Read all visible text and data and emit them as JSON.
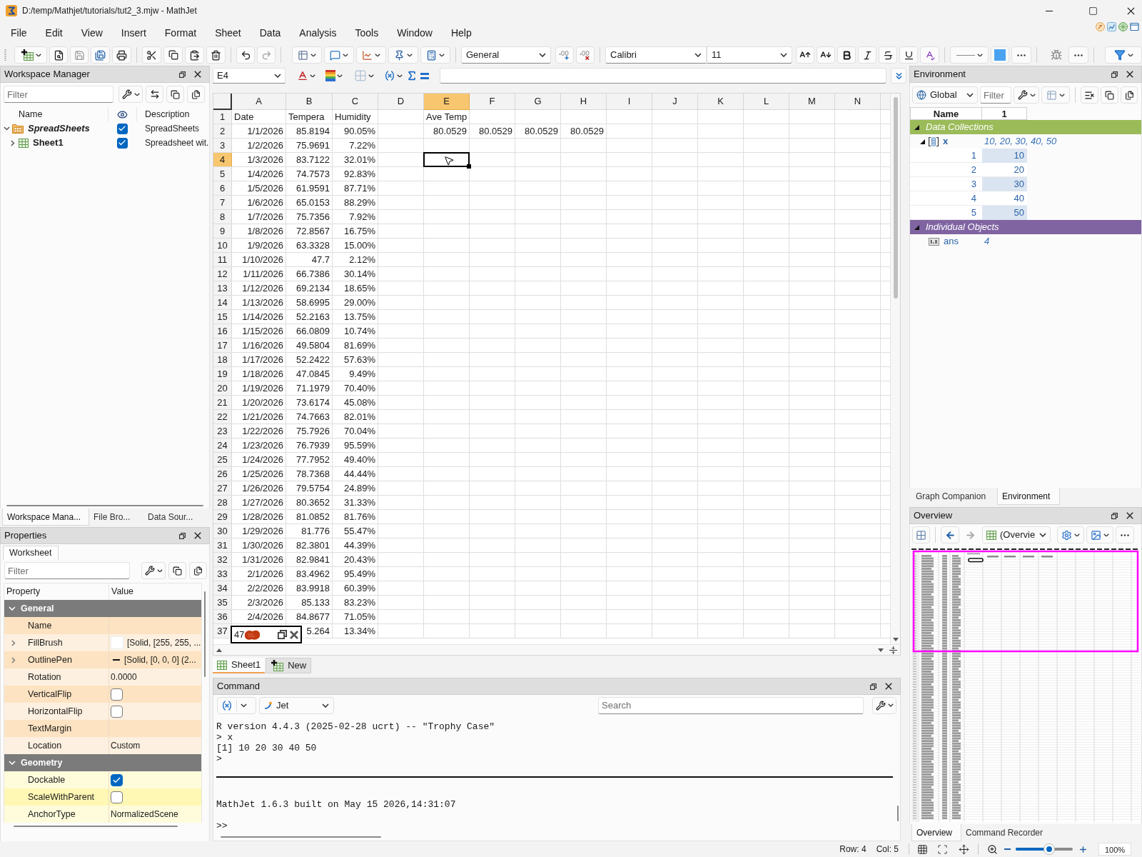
{
  "window": {
    "title": "D:/temp/Mathjet/tutorials/tut2_3.mjw - MathJet"
  },
  "menu": [
    "File",
    "Edit",
    "View",
    "Insert",
    "Format",
    "Sheet",
    "Data",
    "Analysis",
    "Tools",
    "Window",
    "Help"
  ],
  "toolbar": {
    "number_format": "General",
    "font": "Calibri",
    "font_size": "11"
  },
  "formula_bar": {
    "cell_ref": "E4"
  },
  "workspace_manager": {
    "title": "Workspace Manager",
    "filter_placeholder": "Filter",
    "columns": [
      "Name",
      "Description"
    ],
    "tree": [
      {
        "kind": "folder",
        "name": "SpreadSheets",
        "visible": true,
        "description": "SpreadSheets",
        "expanded": true,
        "children": [
          {
            "kind": "sheet",
            "name": "Sheet1",
            "visible": true,
            "description": "Spreadsheet wit.",
            "expanded": false
          }
        ]
      }
    ],
    "tabs": [
      {
        "label": "Workspace Mana...",
        "selected": true
      },
      {
        "label": "File Bro...",
        "selected": false
      },
      {
        "label": "Data Sour...",
        "selected": false
      }
    ]
  },
  "properties": {
    "title": "Properties",
    "tabs": [
      {
        "label": "Worksheet",
        "selected": true
      }
    ],
    "filter_placeholder": "Filter",
    "columns": [
      "Property",
      "Value"
    ],
    "groups": [
      {
        "name": "General",
        "expanded": true,
        "rows": [
          {
            "kind": "text",
            "name": "Name"
          },
          {
            "kind": "brush",
            "name": "FillBrush",
            "value": "[Solid, [255, 255, ..."
          },
          {
            "kind": "pen",
            "name": "OutlinePen",
            "value": "[Solid, [0, 0, 0] (2..."
          },
          {
            "kind": "text",
            "name": "Rotation",
            "value": "0.0000"
          },
          {
            "kind": "checkbox",
            "name": "VerticalFlip",
            "checked": false
          },
          {
            "kind": "checkbox",
            "name": "HorizontalFlip",
            "checked": false
          },
          {
            "kind": "text",
            "name": "TextMargin"
          },
          {
            "kind": "text",
            "name": "Location",
            "value": "Custom"
          }
        ]
      },
      {
        "name": "Geometry",
        "expanded": true,
        "rows": [
          {
            "kind": "checkbox",
            "name": "Dockable",
            "checked": true
          },
          {
            "kind": "checkbox",
            "name": "ScaleWithParent",
            "checked": false
          },
          {
            "kind": "text",
            "name": "AnchorType",
            "value": "NormalizedScene"
          }
        ]
      }
    ]
  },
  "sheet": {
    "columns": [
      {
        "label": "A",
        "selected": false
      },
      {
        "label": "B",
        "selected": false
      },
      {
        "label": "C",
        "selected": false
      },
      {
        "label": "D",
        "selected": false
      },
      {
        "label": "E",
        "selected": true
      },
      {
        "label": "F",
        "selected": false
      },
      {
        "label": "G",
        "selected": false
      },
      {
        "label": "H",
        "selected": false
      },
      {
        "label": "I",
        "selected": false
      },
      {
        "label": "J",
        "selected": false
      },
      {
        "label": "K",
        "selected": false
      },
      {
        "label": "L",
        "selected": false
      },
      {
        "label": "M",
        "selected": false
      },
      {
        "label": "N",
        "selected": false
      }
    ],
    "rows": [
      {
        "number": "1",
        "selected": false,
        "cells": [
          {
            "kind": "text",
            "text": "Date"
          },
          {
            "kind": "text",
            "text": "Tempera"
          },
          {
            "kind": "text",
            "text": "Humidity"
          },
          {
            "kind": "blank"
          },
          {
            "kind": "text",
            "text": "Ave Temp"
          }
        ]
      },
      {
        "number": "2",
        "selected": false,
        "cells": [
          {
            "kind": "value",
            "text": "1/1/2026"
          },
          {
            "kind": "value",
            "text": "85.8194"
          },
          {
            "kind": "value",
            "text": "90.05%"
          },
          {
            "kind": "blank"
          },
          {
            "kind": "value",
            "text": "80.0529"
          },
          {
            "kind": "value",
            "text": "80.0529"
          },
          {
            "kind": "value",
            "text": "80.0529"
          },
          {
            "kind": "value",
            "text": "80.0529"
          }
        ]
      },
      {
        "number": "3",
        "selected": false,
        "cells": [
          {
            "kind": "value",
            "text": "1/2/2026"
          },
          {
            "kind": "value",
            "text": "75.9691"
          },
          {
            "kind": "value",
            "text": "7.22%"
          }
        ]
      },
      {
        "number": "4",
        "selected": true,
        "cells": [
          {
            "kind": "value",
            "text": "1/3/2026"
          },
          {
            "kind": "value",
            "text": "83.7122"
          },
          {
            "kind": "value",
            "text": "32.01%"
          }
        ]
      },
      {
        "number": "5",
        "selected": false,
        "cells": [
          {
            "kind": "value",
            "text": "1/4/2026"
          },
          {
            "kind": "value",
            "text": "74.7573"
          },
          {
            "kind": "value",
            "text": "92.83%"
          }
        ]
      },
      {
        "number": "6",
        "selected": false,
        "cells": [
          {
            "kind": "value",
            "text": "1/5/2026"
          },
          {
            "kind": "value",
            "text": "61.9591"
          },
          {
            "kind": "value",
            "text": "87.71%"
          }
        ]
      },
      {
        "number": "7",
        "selected": false,
        "cells": [
          {
            "kind": "value",
            "text": "1/6/2026"
          },
          {
            "kind": "value",
            "text": "65.0153"
          },
          {
            "kind": "value",
            "text": "88.29%"
          }
        ]
      },
      {
        "number": "8",
        "selected": false,
        "cells": [
          {
            "kind": "value",
            "text": "1/7/2026"
          },
          {
            "kind": "value",
            "text": "75.7356"
          },
          {
            "kind": "value",
            "text": "7.92%"
          }
        ]
      },
      {
        "number": "9",
        "selected": false,
        "cells": [
          {
            "kind": "value",
            "text": "1/8/2026"
          },
          {
            "kind": "value",
            "text": "72.8567"
          },
          {
            "kind": "value",
            "text": "16.75%"
          }
        ]
      },
      {
        "number": "10",
        "selected": false,
        "cells": [
          {
            "kind": "value",
            "text": "1/9/2026"
          },
          {
            "kind": "value",
            "text": "63.3328"
          },
          {
            "kind": "value",
            "text": "15.00%"
          }
        ]
      },
      {
        "number": "11",
        "selected": false,
        "cells": [
          {
            "kind": "value",
            "text": "1/10/2026"
          },
          {
            "kind": "value",
            "text": "47.7"
          },
          {
            "kind": "value",
            "text": "2.12%"
          }
        ]
      },
      {
        "number": "12",
        "selected": false,
        "cells": [
          {
            "kind": "value",
            "text": "1/11/2026"
          },
          {
            "kind": "value",
            "text": "66.7386"
          },
          {
            "kind": "value",
            "text": "30.14%"
          }
        ]
      },
      {
        "number": "13",
        "selected": false,
        "cells": [
          {
            "kind": "value",
            "text": "1/12/2026"
          },
          {
            "kind": "value",
            "text": "69.2134"
          },
          {
            "kind": "value",
            "text": "18.65%"
          }
        ]
      },
      {
        "number": "14",
        "selected": false,
        "cells": [
          {
            "kind": "value",
            "text": "1/13/2026"
          },
          {
            "kind": "value",
            "text": "58.6995"
          },
          {
            "kind": "value",
            "text": "29.00%"
          }
        ]
      },
      {
        "number": "15",
        "selected": false,
        "cells": [
          {
            "kind": "value",
            "text": "1/14/2026"
          },
          {
            "kind": "value",
            "text": "52.2163"
          },
          {
            "kind": "value",
            "text": "13.75%"
          }
        ]
      },
      {
        "number": "16",
        "selected": false,
        "cells": [
          {
            "kind": "value",
            "text": "1/15/2026"
          },
          {
            "kind": "value",
            "text": "66.0809"
          },
          {
            "kind": "value",
            "text": "10.74%"
          }
        ]
      },
      {
        "number": "17",
        "selected": false,
        "cells": [
          {
            "kind": "value",
            "text": "1/16/2026"
          },
          {
            "kind": "value",
            "text": "49.5804"
          },
          {
            "kind": "value",
            "text": "81.69%"
          }
        ]
      },
      {
        "number": "18",
        "selected": false,
        "cells": [
          {
            "kind": "value",
            "text": "1/17/2026"
          },
          {
            "kind": "value",
            "text": "52.2422"
          },
          {
            "kind": "value",
            "text": "57.63%"
          }
        ]
      },
      {
        "number": "19",
        "selected": false,
        "cells": [
          {
            "kind": "value",
            "text": "1/18/2026"
          },
          {
            "kind": "value",
            "text": "47.0845"
          },
          {
            "kind": "value",
            "text": "9.49%"
          }
        ]
      },
      {
        "number": "20",
        "selected": false,
        "cells": [
          {
            "kind": "value",
            "text": "1/19/2026"
          },
          {
            "kind": "value",
            "text": "71.1979"
          },
          {
            "kind": "value",
            "text": "70.40%"
          }
        ]
      },
      {
        "number": "21",
        "selected": false,
        "cells": [
          {
            "kind": "value",
            "text": "1/20/2026"
          },
          {
            "kind": "value",
            "text": "73.6174"
          },
          {
            "kind": "value",
            "text": "45.08%"
          }
        ]
      },
      {
        "number": "22",
        "selected": false,
        "cells": [
          {
            "kind": "value",
            "text": "1/21/2026"
          },
          {
            "kind": "value",
            "text": "74.7663"
          },
          {
            "kind": "value",
            "text": "82.01%"
          }
        ]
      },
      {
        "number": "23",
        "selected": false,
        "cells": [
          {
            "kind": "value",
            "text": "1/22/2026"
          },
          {
            "kind": "value",
            "text": "75.7926"
          },
          {
            "kind": "value",
            "text": "70.04%"
          }
        ]
      },
      {
        "number": "24",
        "selected": false,
        "cells": [
          {
            "kind": "value",
            "text": "1/23/2026"
          },
          {
            "kind": "value",
            "text": "76.7939"
          },
          {
            "kind": "value",
            "text": "95.59%"
          }
        ]
      },
      {
        "number": "25",
        "selected": false,
        "cells": [
          {
            "kind": "value",
            "text": "1/24/2026"
          },
          {
            "kind": "value",
            "text": "77.7952"
          },
          {
            "kind": "value",
            "text": "49.40%"
          }
        ]
      },
      {
        "number": "26",
        "selected": false,
        "cells": [
          {
            "kind": "value",
            "text": "1/25/2026"
          },
          {
            "kind": "value",
            "text": "78.7368"
          },
          {
            "kind": "value",
            "text": "44.44%"
          }
        ]
      },
      {
        "number": "27",
        "selected": false,
        "cells": [
          {
            "kind": "value",
            "text": "1/26/2026"
          },
          {
            "kind": "value",
            "text": "79.5754"
          },
          {
            "kind": "value",
            "text": "24.89%"
          }
        ]
      },
      {
        "number": "28",
        "selected": false,
        "cells": [
          {
            "kind": "value",
            "text": "1/27/2026"
          },
          {
            "kind": "value",
            "text": "80.3652"
          },
          {
            "kind": "value",
            "text": "31.33%"
          }
        ]
      },
      {
        "number": "29",
        "selected": false,
        "cells": [
          {
            "kind": "value",
            "text": "1/28/2026"
          },
          {
            "kind": "value",
            "text": "81.0852"
          },
          {
            "kind": "value",
            "text": "81.76%"
          }
        ]
      },
      {
        "number": "30",
        "selected": false,
        "cells": [
          {
            "kind": "value",
            "text": "1/29/2026"
          },
          {
            "kind": "value",
            "text": "81.776"
          },
          {
            "kind": "value",
            "text": "55.47%"
          }
        ]
      },
      {
        "number": "31",
        "selected": false,
        "cells": [
          {
            "kind": "value",
            "text": "1/30/2026"
          },
          {
            "kind": "value",
            "text": "82.3801"
          },
          {
            "kind": "value",
            "text": "44.39%"
          }
        ]
      },
      {
        "number": "32",
        "selected": false,
        "cells": [
          {
            "kind": "value",
            "text": "1/31/2026"
          },
          {
            "kind": "value",
            "text": "82.9841"
          },
          {
            "kind": "value",
            "text": "20.43%"
          }
        ]
      },
      {
        "number": "33",
        "selected": false,
        "cells": [
          {
            "kind": "value",
            "text": "2/1/2026"
          },
          {
            "kind": "value",
            "text": "83.4962"
          },
          {
            "kind": "value",
            "text": "95.49%"
          }
        ]
      },
      {
        "number": "34",
        "selected": false,
        "cells": [
          {
            "kind": "value",
            "text": "2/2/2026"
          },
          {
            "kind": "value",
            "text": "83.9918"
          },
          {
            "kind": "value",
            "text": "60.39%"
          }
        ]
      },
      {
        "number": "35",
        "selected": false,
        "cells": [
          {
            "kind": "value",
            "text": "2/3/2026"
          },
          {
            "kind": "value",
            "text": "85.133"
          },
          {
            "kind": "value",
            "text": "83.23%"
          }
        ]
      },
      {
        "number": "36",
        "selected": false,
        "cells": [
          {
            "kind": "value",
            "text": "2/4/2026"
          },
          {
            "kind": "value",
            "text": "84.8677"
          },
          {
            "kind": "value",
            "text": "71.05%"
          }
        ]
      },
      {
        "number": "37",
        "selected": false,
        "cells": [
          {
            "kind": "blank"
          },
          {
            "kind": "value",
            "text": "5.264"
          },
          {
            "kind": "value",
            "text": "13.34%"
          }
        ]
      }
    ],
    "popup": {
      "text": "47"
    }
  },
  "sheet_tabs": [
    {
      "kind": "sheet",
      "label": "Sheet1",
      "selected": true
    },
    {
      "kind": "add",
      "label": "New",
      "selected": false
    }
  ],
  "command": {
    "title": "Command",
    "mode": "Jet",
    "search_placeholder": "Search",
    "lines": [
      "R version 4.4.3 (2025-02-28 ucrt) -- \"Trophy Case\"",
      "> x",
      "[1] 10 20 30 40 50",
      ">"
    ],
    "banner": "MathJet 1.6.3 built on May 15 2026,14:31:07",
    "prompt": ">>"
  },
  "environment": {
    "title": "Environment",
    "scope": "Global",
    "filter_placeholder": "Filter",
    "columns": [
      "Name",
      "1"
    ],
    "groups": [
      {
        "name": "Data Collections",
        "color": "#9bbb59",
        "expanded": true,
        "items": [
          {
            "kind": "vector",
            "name": "x",
            "value": "10, 20, 30, 40, 50",
            "expanded": true,
            "elements": [
              {
                "index": "1",
                "value": "10"
              },
              {
                "index": "2",
                "value": "20"
              },
              {
                "index": "3",
                "value": "30"
              },
              {
                "index": "4",
                "value": "40"
              },
              {
                "index": "5",
                "value": "50"
              }
            ]
          }
        ]
      },
      {
        "name": "Individual Objects",
        "color": "#8064a2",
        "expanded": true,
        "items": [
          {
            "kind": "scalar",
            "name": "ans",
            "value": "4"
          }
        ]
      }
    ],
    "tabs": [
      {
        "label": "Graph Companion",
        "selected": false
      },
      {
        "label": "Environment",
        "selected": true
      }
    ]
  },
  "overview": {
    "title": "Overview",
    "view": "(Overvie",
    "tabs": [
      {
        "label": "Overview",
        "selected": true
      },
      {
        "label": "Command Recorder",
        "selected": false
      }
    ]
  },
  "status_bar": {
    "row": "Row: 4",
    "col": "Col: 5",
    "zoom": {
      "level": 0.5,
      "reading": "100%"
    }
  }
}
